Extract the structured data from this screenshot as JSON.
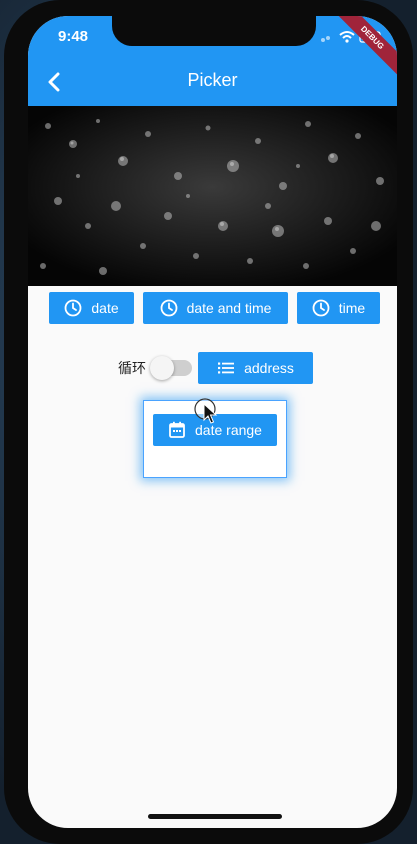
{
  "status_bar": {
    "time": "9:48"
  },
  "app_bar": {
    "title": "Picker",
    "debug_banner": "DEBUG"
  },
  "buttons": {
    "date": "date",
    "date_and_time": "date and time",
    "time": "time",
    "address": "address",
    "date_range": "date range"
  },
  "loop": {
    "label": "循环",
    "enabled": false
  },
  "colors": {
    "primary": "#2196f3",
    "focus": "#4aa3ff"
  },
  "icons": {
    "back": "chevron-left-icon",
    "date": "clock-icon",
    "date_and_time": "clock-icon",
    "time": "clock-icon",
    "address": "list-icon",
    "date_range": "calendar-icon"
  }
}
